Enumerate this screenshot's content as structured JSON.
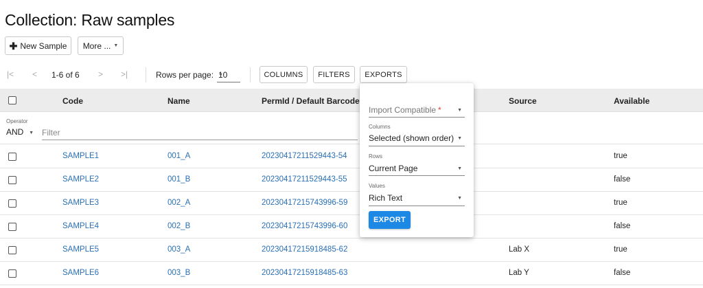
{
  "page": {
    "title": "Collection: Raw samples"
  },
  "actions": {
    "new_sample_label": "New Sample",
    "more_label": "More ..."
  },
  "pagination": {
    "first_icon": "⏮",
    "prev_icon": "‹",
    "next_icon": "›",
    "last_icon": "⏭",
    "range_text": "1-6 of 6",
    "rows_per_page_label": "Rows per page:",
    "rows_per_page_value": "10"
  },
  "toolbar": {
    "columns_label": "COLUMNS",
    "filters_label": "FILTERS",
    "exports_label": "EXPORTS"
  },
  "table": {
    "headers": {
      "code": "Code",
      "name": "Name",
      "permid": "PermId / Default Barcode",
      "source": "Source",
      "available": "Available"
    },
    "filter": {
      "operator_label": "Operator",
      "operator_value": "AND",
      "placeholder": "Filter"
    },
    "rows": [
      {
        "code": "SAMPLE1",
        "name": "001_A",
        "permid": "20230417211529443-54",
        "source": "",
        "available": "true"
      },
      {
        "code": "SAMPLE2",
        "name": "001_B",
        "permid": "20230417211529443-55",
        "source": "",
        "available": "false"
      },
      {
        "code": "SAMPLE3",
        "name": "002_A",
        "permid": "20230417215743996-59",
        "source": "",
        "available": "true"
      },
      {
        "code": "SAMPLE4",
        "name": "002_B",
        "permid": "20230417215743996-60",
        "source": "",
        "available": "false"
      },
      {
        "code": "SAMPLE5",
        "name": "003_A",
        "permid": "20230417215918485-62",
        "source": "Lab X",
        "available": "true"
      },
      {
        "code": "SAMPLE6",
        "name": "003_B",
        "permid": "20230417215918485-63",
        "source": "Lab Y",
        "available": "false"
      }
    ]
  },
  "export_popup": {
    "import_compatible_placeholder": "Import Compatible",
    "required_mark": "*",
    "columns_label": "Columns",
    "columns_value": "Selected (shown order)",
    "rows_label": "Rows",
    "rows_value": "Current Page",
    "values_label": "Values",
    "values_value": "Rich Text",
    "export_button_label": "EXPORT"
  },
  "colors": {
    "link": "#2a6fb5",
    "primary_button": "#1e88e5",
    "header_bg": "#ececec",
    "required": "#e53935"
  }
}
